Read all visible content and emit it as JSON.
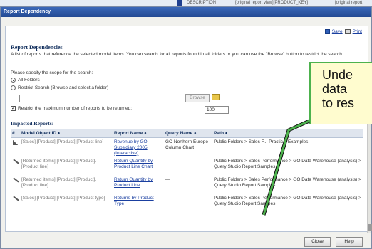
{
  "background": {
    "columns": [
      "DESCRIPTION",
      "[original report view][PRODUCT_KEY]",
      "[original report"
    ]
  },
  "dialog": {
    "title": "Report Dependency",
    "toolbar": {
      "save_label": "Save",
      "print_label": "Print"
    },
    "heading": "Report Dependencies",
    "description": "A list of reports that reference the selected model items. You can search for all reports found in all folders or you can use the \"Browse\" button to restrict the search.",
    "scope_label": "Please specify the scope for the search:",
    "scope_options": [
      {
        "label": "All Folders",
        "selected": true
      },
      {
        "label": "Restrict Search (Browse and select a folder)",
        "selected": false
      }
    ],
    "folder_value": "",
    "browse_label": "Browse",
    "limit": {
      "label": "Restrict the maximum number of reports to be returned:",
      "checked": true,
      "value": "100"
    },
    "impacted_heading": "Impacted Reports:",
    "table": {
      "headers": [
        "#",
        "Model Object ID ♦",
        "Report Name ♦",
        "Query Name ♦",
        "Path ♦"
      ],
      "rows": [
        {
          "icon": "level-icon",
          "model_object_id": "[Sales].[Product].[Product].[Product line]",
          "report_name": "Revenue by GO Subsidiary 2005 (Interactive)",
          "query_name": "GO Northern Europe Column Chart",
          "path": "Public Folders > Sales F... Practical Examples"
        },
        {
          "icon": "item-icon",
          "model_object_id": "[Returned items].[Product].[Product].[Product line]",
          "report_name": "Return Quantity by Product Line Chart",
          "query_name": "—",
          "path": "Public Folders > Sales Performance > GO Data Warehouse (analysis) > Query Studio Report Samples"
        },
        {
          "icon": "item-icon",
          "model_object_id": "[Returned items].[Product].[Product].[Product line]",
          "report_name": "Return Quantity by Product Line",
          "query_name": "—",
          "path": "Public Folders > Sales Performance > GO Data Warehouse (analysis) > Query Studio Report Samples"
        },
        {
          "icon": "item-icon",
          "model_object_id": "[Sales].[Product].[Product].[Product type]",
          "report_name": "Returns by Product Type",
          "query_name": "—",
          "path": "Public Folders > Sales Performance > GO Data Warehouse (analysis) > Query Studio Report Samples"
        }
      ]
    },
    "buttons": {
      "close": "Close",
      "help": "Help"
    }
  },
  "callout": {
    "lines": [
      "Unde",
      "data",
      "to res"
    ]
  },
  "colors": {
    "title_bar": "#2a53a0",
    "heading": "#13305e",
    "link": "#1a3fa0",
    "callout_fill": "#fffccf",
    "callout_border": "#4db24d"
  }
}
